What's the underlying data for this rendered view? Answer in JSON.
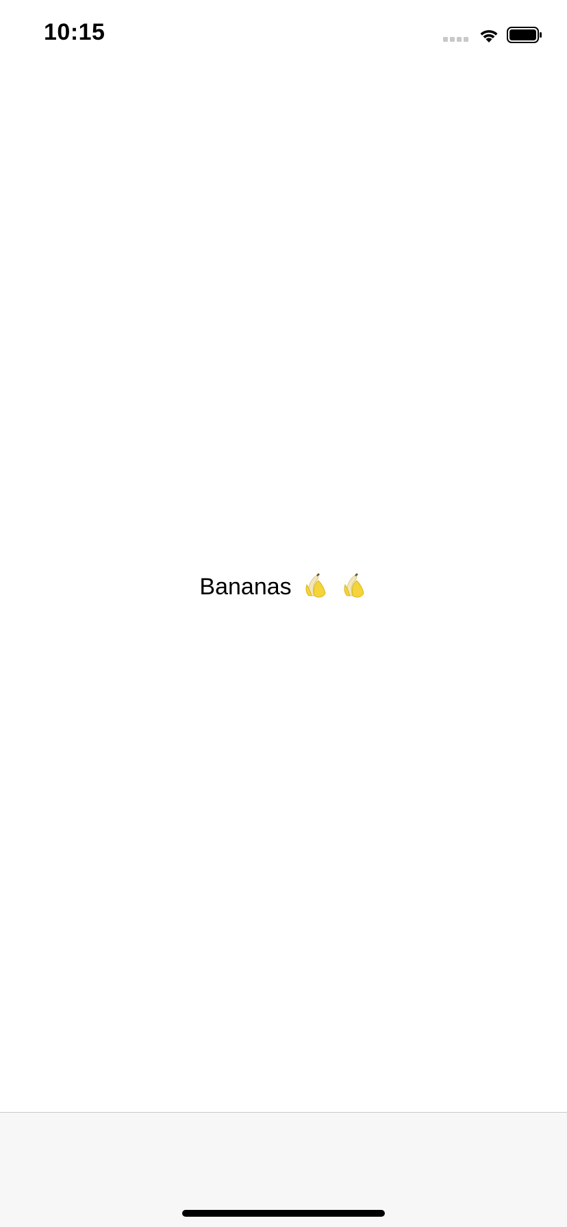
{
  "status_bar": {
    "time": "10:15",
    "icons": [
      "cellular-signal-icon",
      "wifi-icon",
      "battery-icon"
    ]
  },
  "main": {
    "label": "Bananas",
    "emoji_icons": [
      "banana-icon",
      "banana-icon"
    ]
  },
  "colors": {
    "background": "#ffffff",
    "tab_bar_background": "#f7f7f7",
    "text": "#000000",
    "banana_yellow": "#f5d43a",
    "banana_peel_inner": "#f3e6b8"
  }
}
